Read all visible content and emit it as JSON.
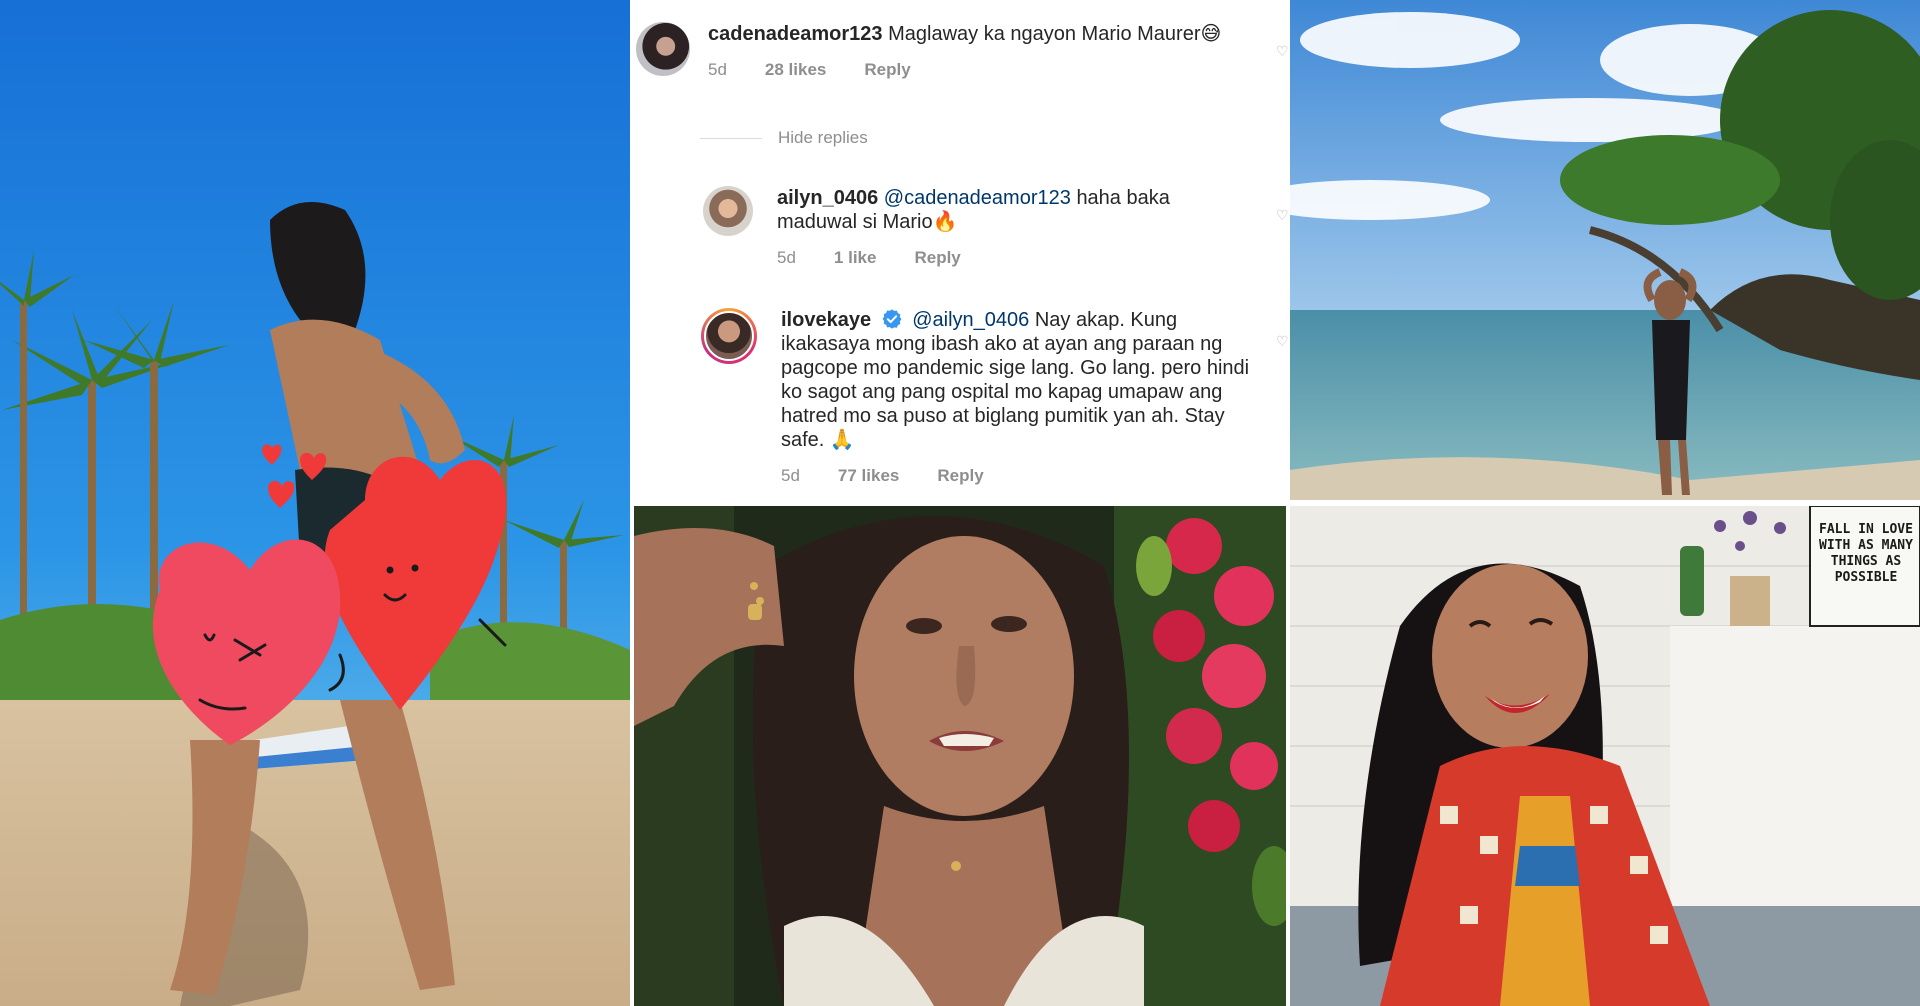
{
  "comments": [
    {
      "username": "cadenadeamor123",
      "text": "Maglaway ka ngayon Mario Maurer",
      "emoji": "😅",
      "age": "5d",
      "likes": "28 likes",
      "reply": "Reply"
    }
  ],
  "thread": {
    "hide_replies": "Hide replies"
  },
  "replies": [
    {
      "username": "ailyn_0406",
      "mention": "@cadenadeamor123",
      "text": "haha baka maduwal si Mario",
      "emoji": "🔥",
      "age": "5d",
      "likes": "1 like",
      "reply": "Reply"
    },
    {
      "username": "ilovekaye",
      "mention": "@ailyn_0406",
      "text": "Nay akap. Kung ikakasaya mong ibash ako at ayan ang paraan ng pagcope mo pandemic sige lang. Go lang. pero hindi ko sagot ang pang ospital mo kapag umapaw ang hatred mo sa puso at biglang pumitik yan ah. Stay safe.",
      "emoji": "🙏",
      "age": "5d",
      "likes": "77 likes",
      "reply": "Reply"
    }
  ],
  "sign": {
    "text": "FALL IN LOVE WITH AS MANY THINGS AS POSSIBLE"
  },
  "colors": {
    "sky": "#1f86e0",
    "sea": "#5fa3b4",
    "heart_red": "#f03a3a",
    "heart_pink": "#ef4a5f",
    "mention": "#00376b",
    "meta_gray": "#8e8e8e"
  }
}
